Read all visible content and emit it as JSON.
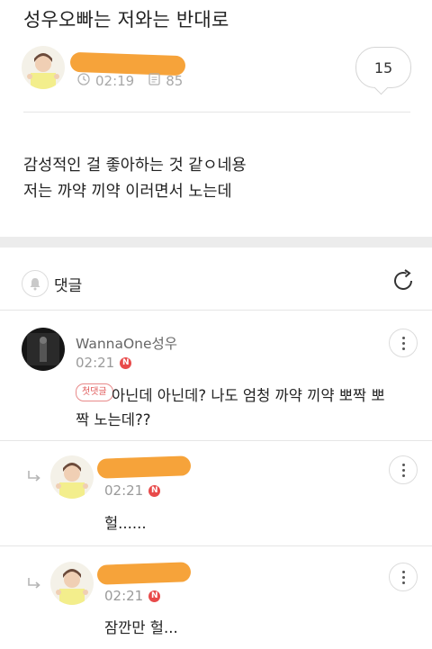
{
  "post": {
    "title": "성우오빠는 저와는 반대로",
    "time": "02:19",
    "views": "85",
    "comment_count": "15",
    "body_lines": [
      "감성적인 걸 좋아하는 것 같ㅇ네용",
      "저는 까약 끼약 이러면서 노는데"
    ]
  },
  "comments_header": {
    "label": "댓글"
  },
  "comments": [
    {
      "author": "WannaOne성우",
      "time": "02:21",
      "new_badge": "N",
      "first_badge": "첫댓글",
      "text_line1": "아닌데 아닌데? 나도 엄청 까약 끼약 뽀짝 뽀",
      "text_line2": "짝 노는데??"
    },
    {
      "time": "02:21",
      "new_badge": "N",
      "text": "헐......"
    },
    {
      "time": "02:21",
      "new_badge": "N",
      "text": "잠깐만 헐..."
    }
  ],
  "colors": {
    "redaction": "#f6a33a",
    "avatar_shirt": "#f3ee8c",
    "badge": "#e84a4a",
    "band": "#ececec"
  },
  "icons": [
    "clock-icon",
    "document-icon",
    "bell-icon",
    "refresh-icon",
    "more-vert-icon",
    "reply-arrow-icon"
  ]
}
